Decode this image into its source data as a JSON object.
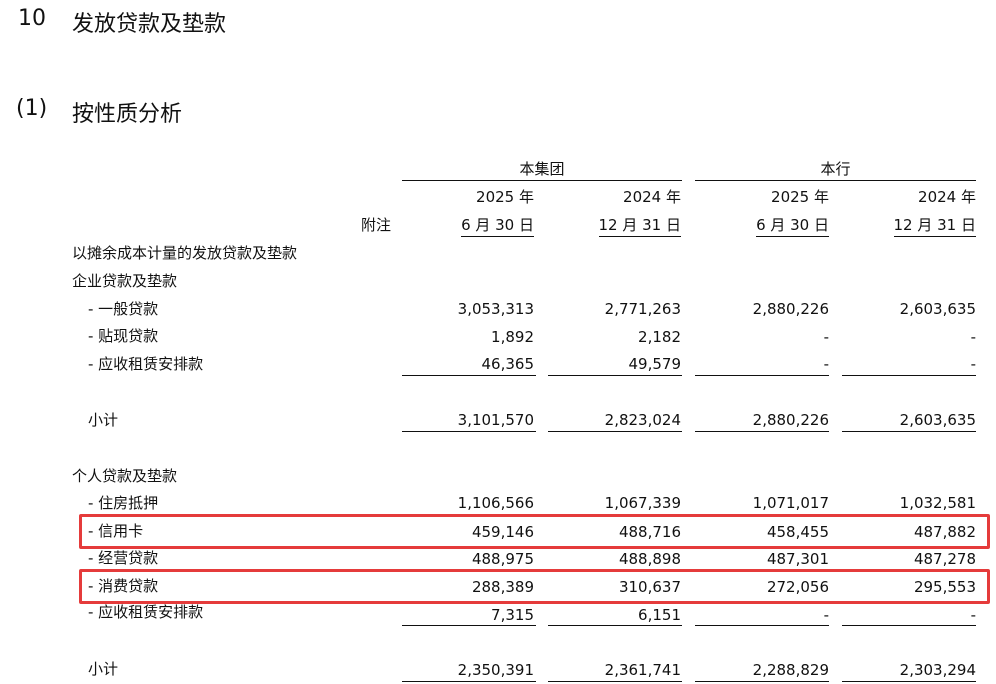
{
  "section": {
    "number": "10",
    "title": "发放贷款及垫款"
  },
  "subsection": {
    "number": "(1)",
    "title": "按性质分析"
  },
  "table": {
    "group_headers": {
      "group": "本集团",
      "bank": "本行"
    },
    "note_header": "附注",
    "columns": [
      {
        "year": "2025 年",
        "date": "6 月 30 日"
      },
      {
        "year": "2024 年",
        "date": "12 月 31 日"
      },
      {
        "year": "2025 年",
        "date": "6 月 30 日"
      },
      {
        "year": "2024 年",
        "date": "12 月 31 日"
      }
    ],
    "title_row": "以摊余成本计量的发放贷款及垫款",
    "corporate": {
      "label": "企业贷款及垫款",
      "rows": [
        {
          "label": "- 一般贷款",
          "values": [
            "3,053,313",
            "2,771,263",
            "2,880,226",
            "2,603,635"
          ]
        },
        {
          "label": "- 贴现贷款",
          "values": [
            "1,892",
            "2,182",
            "-",
            "-"
          ]
        },
        {
          "label": "- 应收租赁安排款",
          "values": [
            "46,365",
            "49,579",
            "-",
            "-"
          ]
        }
      ],
      "subtotal": {
        "label": "小计",
        "values": [
          "3,101,570",
          "2,823,024",
          "2,880,226",
          "2,603,635"
        ]
      }
    },
    "personal": {
      "label": "个人贷款及垫款",
      "rows": [
        {
          "label": "- 住房抵押",
          "values": [
            "1,106,566",
            "1,067,339",
            "1,071,017",
            "1,032,581"
          ]
        },
        {
          "label": "- 信用卡",
          "values": [
            "459,146",
            "488,716",
            "458,455",
            "487,882"
          ]
        },
        {
          "label": "- 经营贷款",
          "values": [
            "488,975",
            "488,898",
            "487,301",
            "487,278"
          ]
        },
        {
          "label": "- 消费贷款",
          "values": [
            "288,389",
            "310,637",
            "272,056",
            "295,553"
          ]
        },
        {
          "label": "- 应收租赁安排款",
          "values": [
            "7,315",
            "6,151",
            "-",
            "-"
          ]
        }
      ],
      "subtotal": {
        "label": "小计",
        "values": [
          "2,350,391",
          "2,361,741",
          "2,288,829",
          "2,303,294"
        ]
      }
    }
  },
  "highlight_color": "#e53b3b"
}
